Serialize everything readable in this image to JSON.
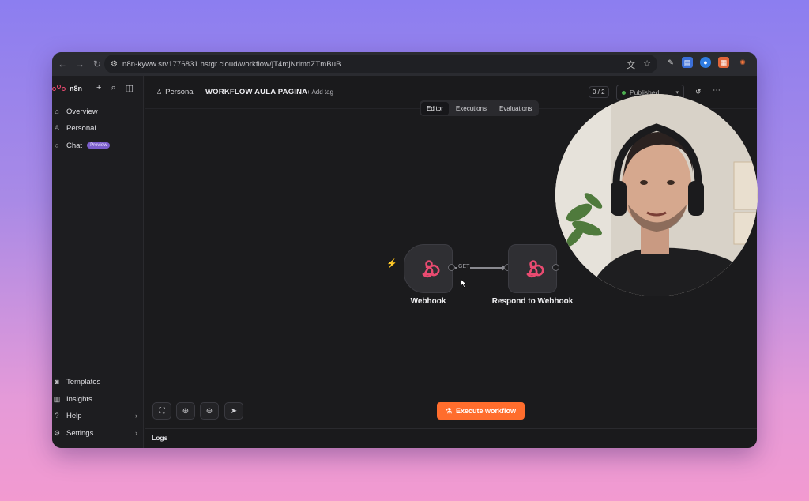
{
  "browser": {
    "url": "n8n-kyww.srv1776831.hstgr.cloud/workflow/jT4mjNrlmdZTmBuB"
  },
  "sidebar": {
    "brand": "n8n",
    "items": [
      {
        "label": "Overview"
      },
      {
        "label": "Personal"
      },
      {
        "label": "Chat",
        "badge": "Preview"
      }
    ],
    "bottom_items": [
      {
        "label": "Templates"
      },
      {
        "label": "Insights"
      },
      {
        "label": "Help"
      },
      {
        "label": "Settings"
      }
    ]
  },
  "header": {
    "breadcrumb": "Personal",
    "workflow_title": "WORKFLOW AULA PAGINA",
    "add_tag": "+ Add tag",
    "counter": "0 / 2",
    "status": "Published"
  },
  "tabs": [
    {
      "label": "Editor",
      "active": true
    },
    {
      "label": "Executions",
      "active": false
    },
    {
      "label": "Evaluations",
      "active": false
    }
  ],
  "nodes": [
    {
      "label": "Webhook",
      "icon": "webhook-icon"
    },
    {
      "label": "Respond to Webhook",
      "icon": "webhook-icon"
    }
  ],
  "edge_label": "GET",
  "execute_button": "Execute workflow",
  "logs_label": "Logs",
  "colors": {
    "accent": "#ff6d2d",
    "node_icon": "#ea4b71",
    "preview_badge": "#7b5ecb"
  }
}
